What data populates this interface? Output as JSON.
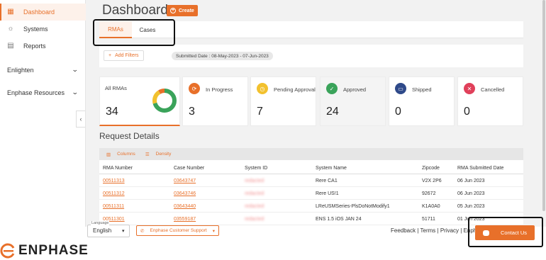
{
  "sidebar": {
    "items": [
      {
        "label": "Dashboard",
        "icon": "dashboard-icon"
      },
      {
        "label": "Systems",
        "icon": "sun-icon"
      },
      {
        "label": "Reports",
        "icon": "report-icon"
      }
    ],
    "groups": [
      {
        "label": "Enlighten"
      },
      {
        "label": "Enphase Resources"
      }
    ]
  },
  "header": {
    "title": "Dashboard",
    "create_label": "Create"
  },
  "tabs": [
    {
      "label": "RMAs"
    },
    {
      "label": "Cases"
    }
  ],
  "filters": {
    "add_label": "Add Filters",
    "chip": "Submitted Date : 08-May-2023 - 07-Jun-2023"
  },
  "cards": [
    {
      "label": "All RMAs",
      "value": "34"
    },
    {
      "label": "In Progress",
      "value": "3",
      "color": "#e8702a",
      "icon": "refresh-icon"
    },
    {
      "label": "Pending Approval",
      "value": "7",
      "color": "#f2c12e",
      "icon": "clock-icon"
    },
    {
      "label": "Approved",
      "value": "24",
      "color": "#3aa35a",
      "icon": "check-icon"
    },
    {
      "label": "Shipped",
      "value": "0",
      "color": "#2f4a8a",
      "icon": "truck-icon"
    },
    {
      "label": "Cancelled",
      "value": "0",
      "color": "#e0405a",
      "icon": "x-icon"
    }
  ],
  "donut": {
    "approved": 24,
    "pending": 7,
    "in_progress": 3,
    "colors": [
      "#3aa35a",
      "#f2c12e",
      "#e8702a"
    ]
  },
  "section_title": "Request Details",
  "table": {
    "toolbar": {
      "columns": "Columns",
      "density": "Density"
    },
    "columns": [
      "RMA Number",
      "Case Number",
      "System ID",
      "System Name",
      "Zipcode",
      "RMA Submitted Date"
    ],
    "rows": [
      [
        "00511313",
        "03643747",
        "redacted",
        "Rere CA1",
        "V2X 2P6",
        "06 Jun 2023"
      ],
      [
        "00511312",
        "03643746",
        "redacted",
        "Rere US!1",
        "92672",
        "06 Jun 2023"
      ],
      [
        "00511311",
        "03643440",
        "redacted",
        "LReUSMSeries-PlsDoNotModify1",
        "K1A0A0",
        "05 Jun 2023"
      ],
      [
        "00511301",
        "03559187",
        "redacted",
        "ENS 1.5 iOS JAN 24",
        "51711",
        "01 Jun 2023"
      ]
    ]
  },
  "footer": {
    "language_label": "Language",
    "language_value": "English",
    "support_label": "Enphase Customer Support",
    "links": "Feedback | Terms | Privacy | Enph",
    "logo_text": "ENPHASE",
    "contact_label": "Contact Us"
  },
  "colors": {
    "accent": "#e8702a"
  }
}
